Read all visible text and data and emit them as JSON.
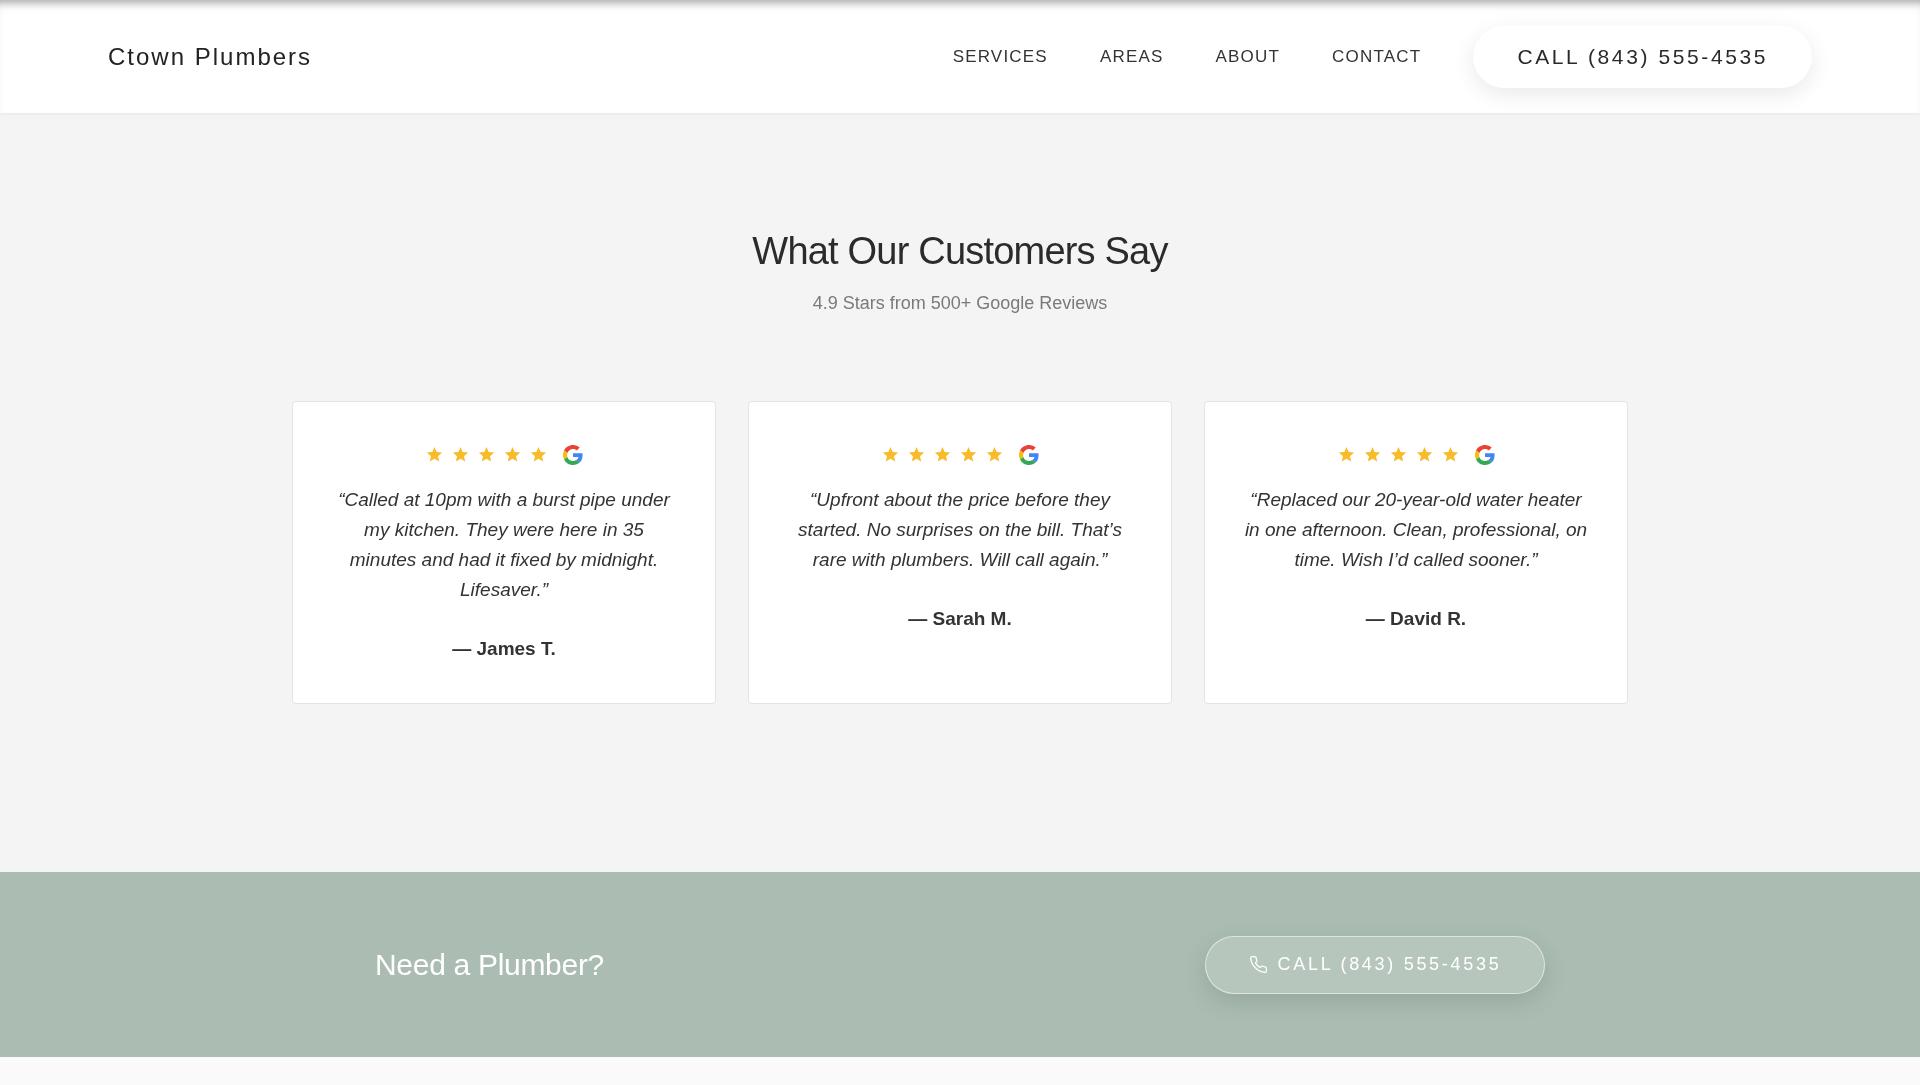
{
  "header": {
    "logo": "Ctown Plumbers",
    "nav": [
      "SERVICES",
      "AREAS",
      "ABOUT",
      "CONTACT"
    ],
    "call_button": "CALL (843) 555-4535"
  },
  "reviews": {
    "title": "What Our Customers Say",
    "subtitle": "4.9 Stars from 500+ Google Reviews",
    "cards": [
      {
        "stars": 5,
        "quote": "“Called at 10pm with a burst pipe under my kitchen. They were here in 35 minutes and had it fixed by midnight. Lifesaver.”",
        "author": "— James T."
      },
      {
        "stars": 5,
        "quote": "“Upfront about the price before they started. No surprises on the bill. That’s rare with plumbers. Will call again.”",
        "author": "— Sarah M."
      },
      {
        "stars": 5,
        "quote": "“Replaced our 20-year-old water heater in one afternoon. Clean, professional, on time. Wish I’d called sooner.”",
        "author": "— David R."
      }
    ]
  },
  "cta": {
    "heading": "Need a Plumber?",
    "button": "CALL (843) 555-4535"
  }
}
